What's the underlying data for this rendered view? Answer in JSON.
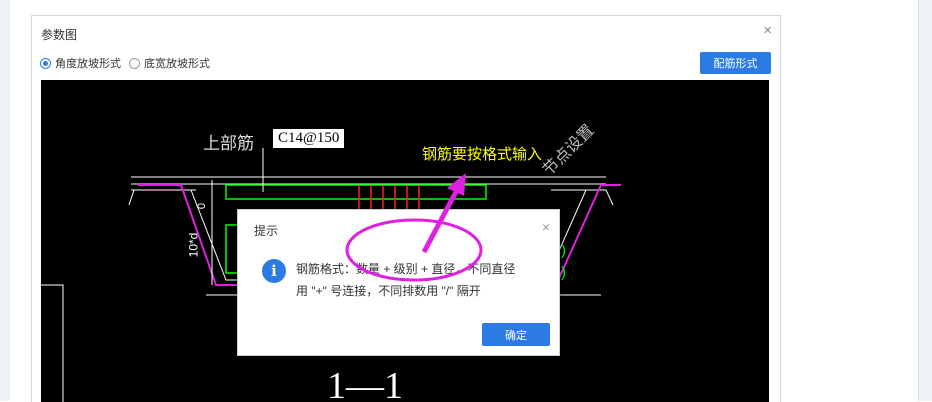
{
  "dialog": {
    "title": "参数图",
    "close_glyph": "×",
    "radio_angle_label": "角度放坡形式",
    "radio_width_label": "底宽放坡形式",
    "selected": "角度放坡形式",
    "rebar_button_label": "配筋形式"
  },
  "drawing": {
    "upper_rebar_label": "上部筋",
    "upper_rebar_value": "C14@150",
    "node_setting_label": "节点设置",
    "dim_zero": "0",
    "dim_10d": "10*d",
    "right_paren_1": ")",
    "right_paren_2": ")",
    "section_label": "1—1"
  },
  "annotation": {
    "hint_text": "钢筋要按格式输入",
    "color": "#ffff00",
    "marker_color": "#e020e0"
  },
  "popup": {
    "title": "提示",
    "close_glyph": "×",
    "info_icon": "i",
    "line1": "钢筋格式：数量 + 级别 + 直径，不同直径",
    "line2": "用 \"+\" 号连接，不同排数用 \"/\" 隔开",
    "ok_label": "确定"
  },
  "colors": {
    "accent": "#2c7be5",
    "canvas_bg": "#000000"
  }
}
